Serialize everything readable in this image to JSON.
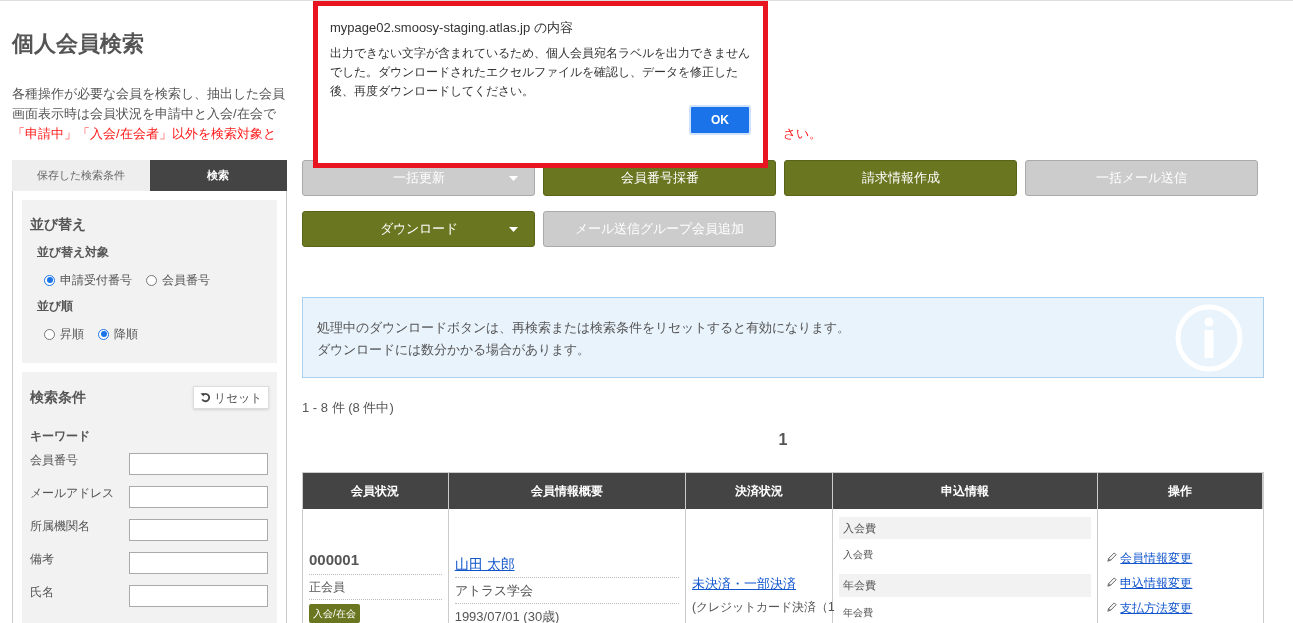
{
  "page": {
    "title": "個人会員検索",
    "intro": [
      "各種操作が必要な会員を検索し、抽出した会員",
      "画面表示時は会員状況を申請中と入会/在会で"
    ],
    "warning": {
      "left": "「申請中」「入会/在会者」以外を検索対象と",
      "right": "さい。"
    }
  },
  "sidebar": {
    "tabs": [
      {
        "label": "保存した検索条件",
        "selected": false
      },
      {
        "label": "検索",
        "selected": true
      }
    ],
    "sort": {
      "title": "並び替え",
      "groups": [
        {
          "label": "並び替え対象",
          "options": [
            {
              "label": "申請受付番号",
              "selected": true
            },
            {
              "label": "会員番号",
              "selected": false
            }
          ]
        },
        {
          "label": "並び順",
          "options": [
            {
              "label": "昇順",
              "selected": false
            },
            {
              "label": "降順",
              "selected": true
            }
          ]
        }
      ]
    },
    "search": {
      "title": "検索条件",
      "reset": "リセット",
      "section": "キーワード",
      "fields": [
        {
          "label": "会員番号"
        },
        {
          "label": "メールアドレス"
        },
        {
          "label": "所属機関名"
        },
        {
          "label": "備考"
        },
        {
          "label": "氏名"
        }
      ]
    }
  },
  "actions": [
    [
      {
        "label": "一括更新",
        "disabled": true,
        "menu": true
      },
      {
        "label": "会員番号採番",
        "disabled": false,
        "menu": false
      },
      {
        "label": "請求情報作成",
        "disabled": false,
        "menu": false
      },
      {
        "label": "一括メール送信",
        "disabled": true,
        "menu": false
      }
    ],
    [
      {
        "label": "ダウンロード",
        "disabled": false,
        "menu": true
      },
      {
        "label": "メール送信グループ会員追加",
        "disabled": true,
        "menu": false
      }
    ]
  ],
  "notice": [
    "処理中のダウンロードボタンは、再検索または検索条件をリセットすると有効になります。",
    "ダウンロードには数分かかる場合があります。"
  ],
  "count": "1 - 8 件 (8 件中)",
  "pages": [
    {
      "label": "1",
      "selected": true
    }
  ],
  "table": {
    "columns": [
      "会員状況",
      "会員情報概要",
      "決済状況",
      "申込情報",
      "操作"
    ],
    "rows": [
      {
        "number": "000001",
        "type": "正会員",
        "status": "入会/在会",
        "name": "山田 太郎",
        "org": "アトラス学会",
        "birth": "1993/07/01 (30歳)",
        "payment": "未決済・一部決済",
        "payment_note": "(クレジットカード決済（1",
        "fees": [
          {
            "heading": "入会費",
            "item": "入会費"
          },
          {
            "heading": "年会費",
            "item": "年会費"
          }
        ],
        "operations": [
          "会員情報変更",
          "申込情報変更",
          "支払方法変更"
        ]
      }
    ]
  },
  "dialog": {
    "title": "mypage02.smoosy-staging.atlas.jp の内容",
    "message": "出力できない文字が含まれているため、個人会員宛名ラベルを出力できませんでした。ダウンロードされたエクセルファイルを確認し、データを修正した後、再度ダウンロードしてください。",
    "button": "OK"
  }
}
